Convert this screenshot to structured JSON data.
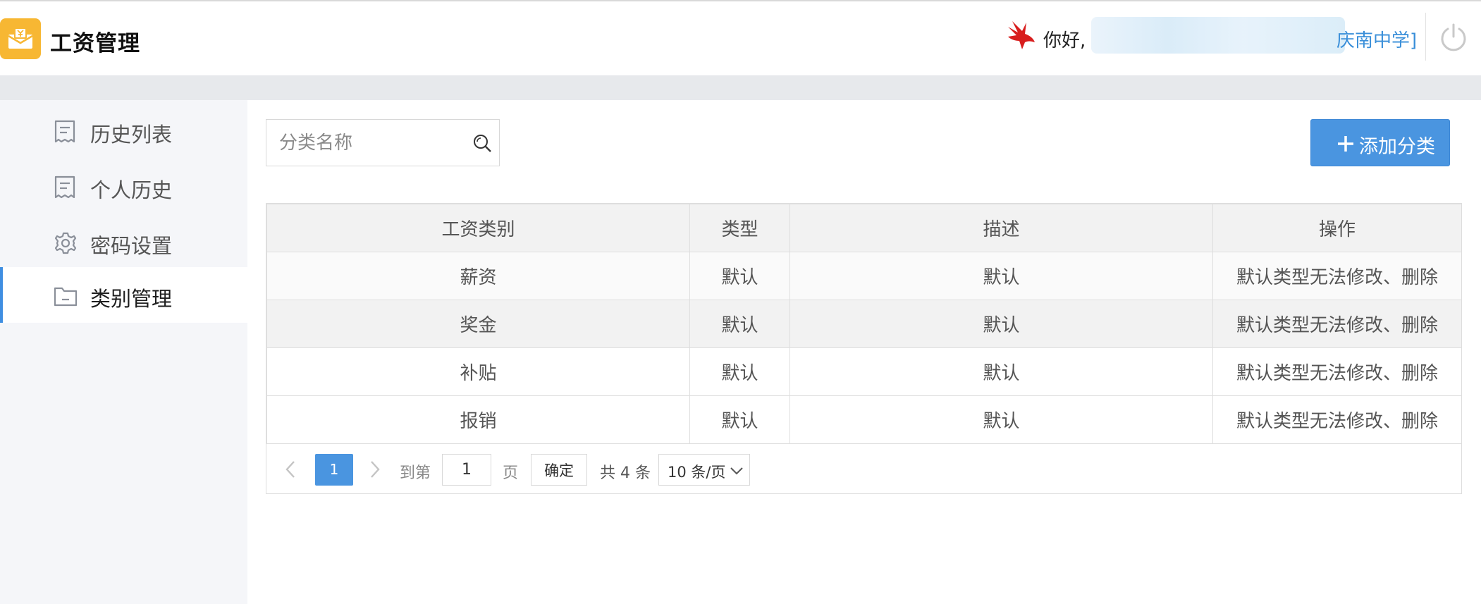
{
  "header": {
    "app_title": "工资管理",
    "greeting": "你好,",
    "school": "庆南中学]"
  },
  "sidebar": {
    "items": [
      {
        "label": "历史列表",
        "icon": "receipt-icon"
      },
      {
        "label": "个人历史",
        "icon": "receipt-icon"
      },
      {
        "label": "密码设置",
        "icon": "gear-icon"
      },
      {
        "label": "类别管理",
        "icon": "folder-icon",
        "active": true
      }
    ]
  },
  "search": {
    "placeholder": "分类名称"
  },
  "add_button": {
    "label": "添加分类"
  },
  "table": {
    "columns": [
      "工资类别",
      "类型",
      "描述",
      "操作"
    ],
    "rows": [
      [
        "薪资",
        "默认",
        "默认",
        "默认类型无法修改、删除"
      ],
      [
        "奖金",
        "默认",
        "默认",
        "默认类型无法修改、删除"
      ],
      [
        "补贴",
        "默认",
        "默认",
        "默认类型无法修改、删除"
      ],
      [
        "报销",
        "默认",
        "默认",
        "默认类型无法修改、删除"
      ]
    ]
  },
  "pagination": {
    "current_page": "1",
    "goto_label": "到第",
    "goto_value": "1",
    "page_label": "页",
    "confirm_label": "确定",
    "total_label": "共 4 条",
    "page_size_label": "10 条/页"
  },
  "colors": {
    "accent": "#4a95e0",
    "logo": "#f7b733",
    "active_border": "#3f8ee1"
  }
}
